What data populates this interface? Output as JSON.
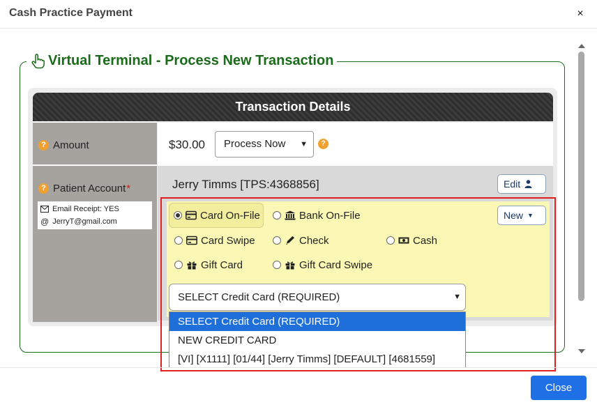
{
  "dialog": {
    "title": "Cash Practice Payment",
    "close_glyph": "×"
  },
  "section": {
    "legend": "Virtual Terminal - Process New Transaction"
  },
  "panel": {
    "title": "Transaction Details"
  },
  "amount": {
    "label": "Amount",
    "value": "$30.00",
    "process_select_value": "Process Now"
  },
  "patient": {
    "label": "Patient Account",
    "required_marker": "*",
    "name": "Jerry Timms [TPS:4368856]",
    "edit_label": "Edit",
    "email_receipt": "Email Receipt: YES",
    "email_address": "JerryT@gmail.com"
  },
  "payment_methods": {
    "new_label": "New",
    "options": [
      {
        "label": "Card On-File",
        "icon": "credit-card-icon",
        "checked": true
      },
      {
        "label": "Bank On-File",
        "icon": "bank-icon",
        "checked": false
      },
      {
        "label": "Card Swipe",
        "icon": "credit-card-icon",
        "checked": false
      },
      {
        "label": "Check",
        "icon": "pencil-icon",
        "checked": false
      },
      {
        "label": "Cash",
        "icon": "money-bill-icon",
        "checked": false
      },
      {
        "label": "Gift Card",
        "icon": "gift-icon",
        "checked": false
      },
      {
        "label": "Gift Card Swipe",
        "icon": "gift-icon",
        "checked": false
      }
    ]
  },
  "credit_card_select": {
    "value": "SELECT Credit Card (REQUIRED)",
    "options": [
      "SELECT Credit Card (REQUIRED)",
      "NEW CREDIT CARD",
      "[VI] [X1111] [01/44] [Jerry Timms] [DEFAULT] [4681559]"
    ],
    "highlighted_index": 0
  },
  "footer": {
    "close_label": "Close"
  },
  "colors": {
    "accent_green": "#1a6b1a",
    "primary_blue": "#1f6fe5",
    "highlight_red": "#e02020",
    "question_orange": "#f0a030"
  }
}
